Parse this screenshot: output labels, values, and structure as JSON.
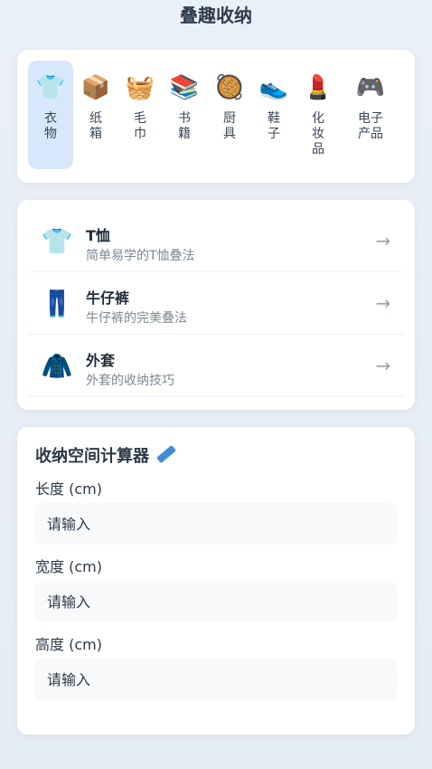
{
  "app": {
    "title": "叠趣收纳"
  },
  "categories": [
    {
      "label": "衣物",
      "icon": "tshirt-icon",
      "glyph": "👕",
      "active": true
    },
    {
      "label": "纸箱",
      "icon": "box-icon",
      "glyph": "📦",
      "active": false
    },
    {
      "label": "毛巾",
      "icon": "basket-icon",
      "glyph": "🧺",
      "active": false
    },
    {
      "label": "书籍",
      "icon": "books-icon",
      "glyph": "📚",
      "active": false
    },
    {
      "label": "厨具",
      "icon": "pan-icon",
      "glyph": "🥘",
      "active": false
    },
    {
      "label": "鞋子",
      "icon": "shoe-icon",
      "glyph": "👟",
      "active": false
    },
    {
      "label": "化妆品",
      "icon": "lipstick-icon",
      "glyph": "💄",
      "active": false
    },
    {
      "label": "电子产品",
      "icon": "gamepad-icon",
      "glyph": "🎮",
      "active": false
    }
  ],
  "guides": [
    {
      "title": "T恤",
      "subtitle": "简单易学的T恤叠法",
      "icon": "tshirt-icon",
      "glyph": "👕",
      "arrow": "→"
    },
    {
      "title": "牛仔裤",
      "subtitle": "牛仔裤的完美叠法",
      "icon": "jeans-icon",
      "glyph": "👖",
      "arrow": "→"
    },
    {
      "title": "外套",
      "subtitle": "外套的收纳技巧",
      "icon": "coat-icon",
      "glyph": "🧥",
      "arrow": "→"
    }
  ],
  "calculator": {
    "title": "收纳空间计算器",
    "title_icon": "ruler-icon",
    "fields": [
      {
        "label": "长度 (cm)",
        "placeholder": "请输入"
      },
      {
        "label": "宽度 (cm)",
        "placeholder": "请输入"
      },
      {
        "label": "高度 (cm)",
        "placeholder": "请输入"
      }
    ]
  },
  "colors": {
    "accent": "#3f8fd8",
    "active_category_bg": "#d6e8fa",
    "page_bg": "#e8eef5"
  }
}
